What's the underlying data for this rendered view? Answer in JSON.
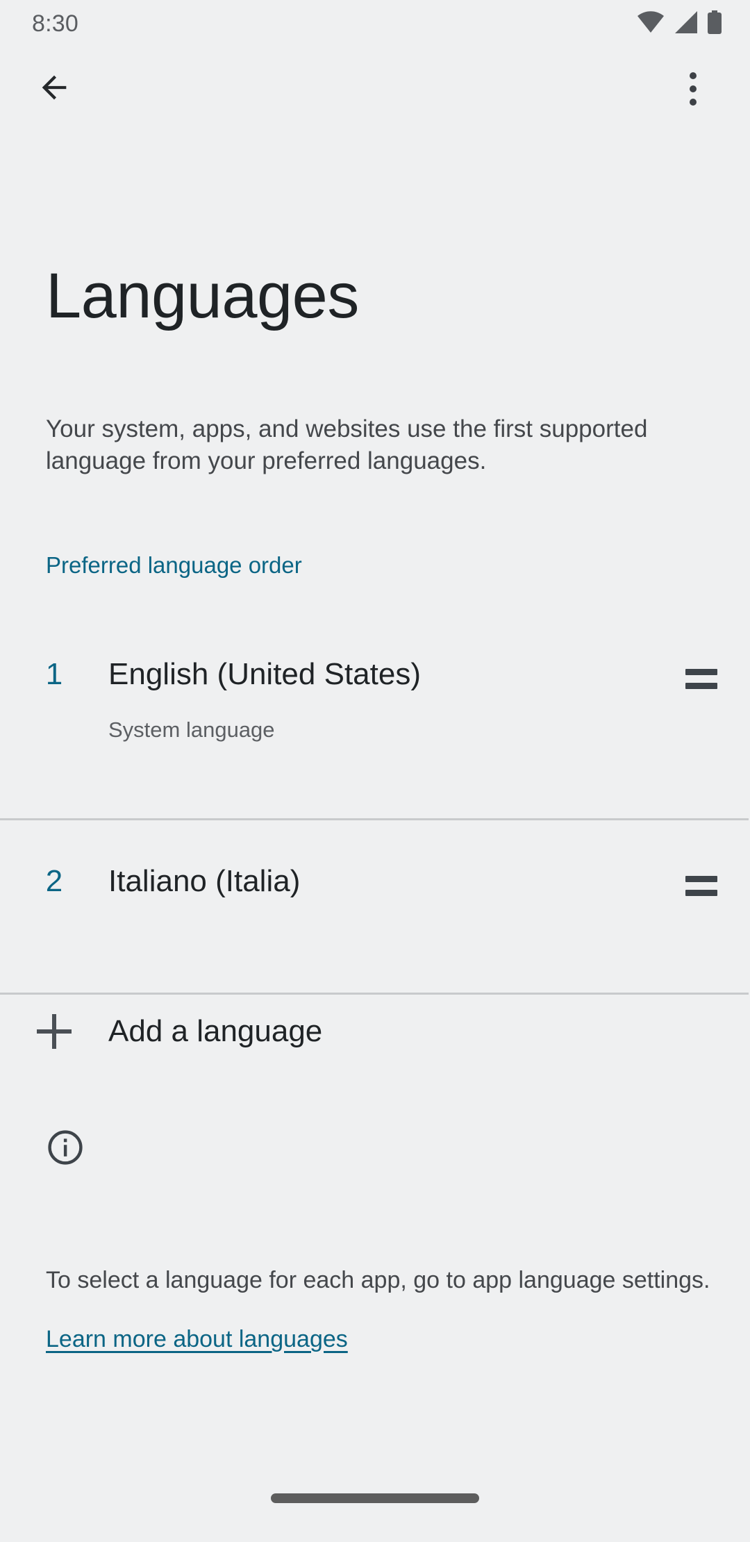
{
  "status_bar": {
    "time": "8:30",
    "icons": [
      "wifi-icon",
      "signal-icon",
      "battery-icon"
    ]
  },
  "app_bar": {
    "back_icon": "back-arrow-icon",
    "overflow_icon": "more-options-icon"
  },
  "page": {
    "title": "Languages",
    "description": "Your system, apps, and websites use the first supported language from your preferred languages."
  },
  "section": {
    "header": "Preferred language order"
  },
  "languages": [
    {
      "index": "1",
      "name": "English (United States)",
      "subtitle": "System language",
      "drag_handle": "drag-handle-icon"
    },
    {
      "index": "2",
      "name": "Italiano (Italia)",
      "subtitle": "",
      "drag_handle": "drag-handle-icon"
    }
  ],
  "add_language": {
    "label": "Add a language",
    "icon": "plus-icon"
  },
  "footer": {
    "icon": "info-icon",
    "text": "To select a language for each app, go to app language settings.",
    "link": "Learn more about languages"
  },
  "colors": {
    "accent": "#0b6585",
    "background": "#eff0f1",
    "text_primary": "#1f2326",
    "text_secondary": "#44474b",
    "divider": "#c8cacc"
  }
}
